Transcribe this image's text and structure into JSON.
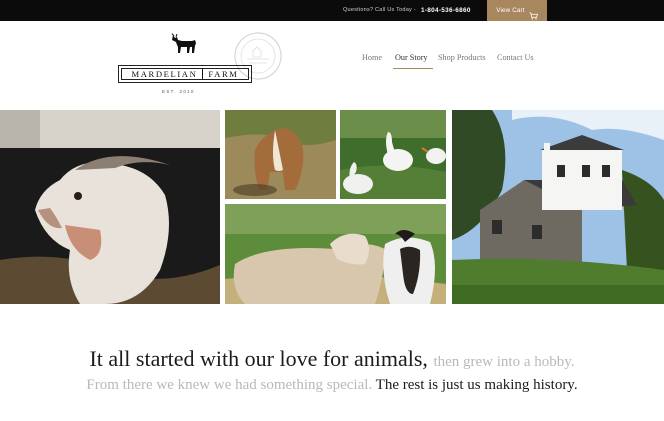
{
  "topbar": {
    "question": "Questions? Call Us Today -",
    "phone": "1-804-536-6860",
    "cart_label": "View Cart",
    "cart_icon": "cart-icon",
    "accent": "#a8875e"
  },
  "logo": {
    "name_left": "MARDELIAN",
    "name_right": "FARM",
    "est": "EST. 2010",
    "stamp_icon": "farm-stamp-icon",
    "goat_icon": "goat-silhouette-icon"
  },
  "nav": {
    "home": "Home",
    "our_story": "Our Story",
    "shop_products": "Shop Products",
    "contact_us": "Contact Us",
    "active": "Our Story"
  },
  "photos": [
    {
      "icon": "goat-closeup-photo"
    },
    {
      "icon": "brown-goat-photo"
    },
    {
      "icon": "white-geese-photo"
    },
    {
      "icon": "two-goats-photo"
    },
    {
      "icon": "stone-farmhouse-photo"
    }
  ],
  "tagline": {
    "line1_dark": "It all started with our love for animals,",
    "line1_light": "then grew into a hobby.",
    "line2_light": "From there we knew we had something special.",
    "line2_dark": "The rest is just us making history."
  }
}
